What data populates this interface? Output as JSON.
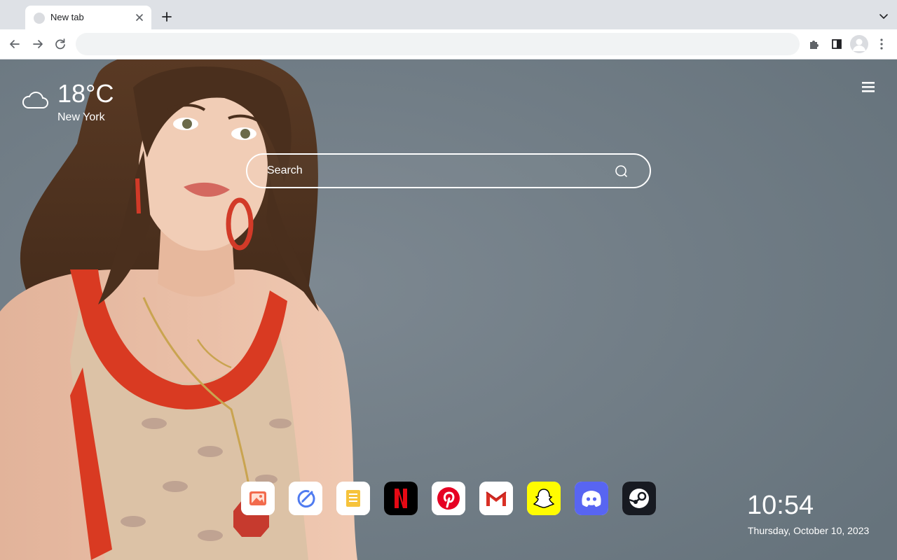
{
  "browser": {
    "tab": {
      "title": "New tab"
    },
    "omnibox": {
      "value": "",
      "placeholder": ""
    }
  },
  "weather": {
    "temperature": "18°C",
    "city": "New York",
    "icon": "cloud-icon"
  },
  "search": {
    "placeholder": "Search"
  },
  "shortcuts": [
    {
      "icon": "photos-icon",
      "color": "#ffffff"
    },
    {
      "icon": "edit-check-icon",
      "color": "#ffffff"
    },
    {
      "icon": "notes-icon",
      "color": "#ffffff"
    },
    {
      "icon": "netflix-icon",
      "color": "#000000"
    },
    {
      "icon": "pinterest-icon",
      "color": "#ffffff"
    },
    {
      "icon": "gmail-icon",
      "color": "#ffffff"
    },
    {
      "icon": "snapchat-icon",
      "color": "#fffc00"
    },
    {
      "icon": "discord-icon",
      "color": "#5865f2"
    },
    {
      "icon": "steam-icon",
      "color": "#171a21"
    }
  ],
  "clock": {
    "time": "10:54",
    "date": "Thursday, October 10, 2023"
  }
}
